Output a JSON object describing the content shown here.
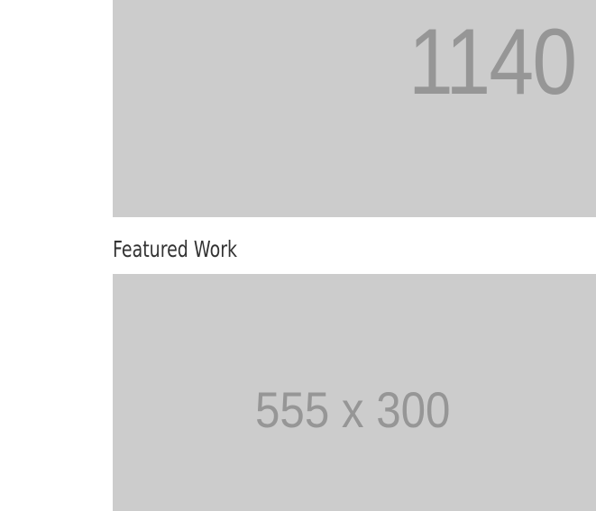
{
  "hero": {
    "placeholder_text": "1140"
  },
  "featured": {
    "title": "Featured Work",
    "placeholder_text": "555 x 300"
  },
  "colors": {
    "placeholder_bg": "#cccccc",
    "placeholder_text": "#969696",
    "title_text": "#333333",
    "page_bg": "#ffffff"
  }
}
